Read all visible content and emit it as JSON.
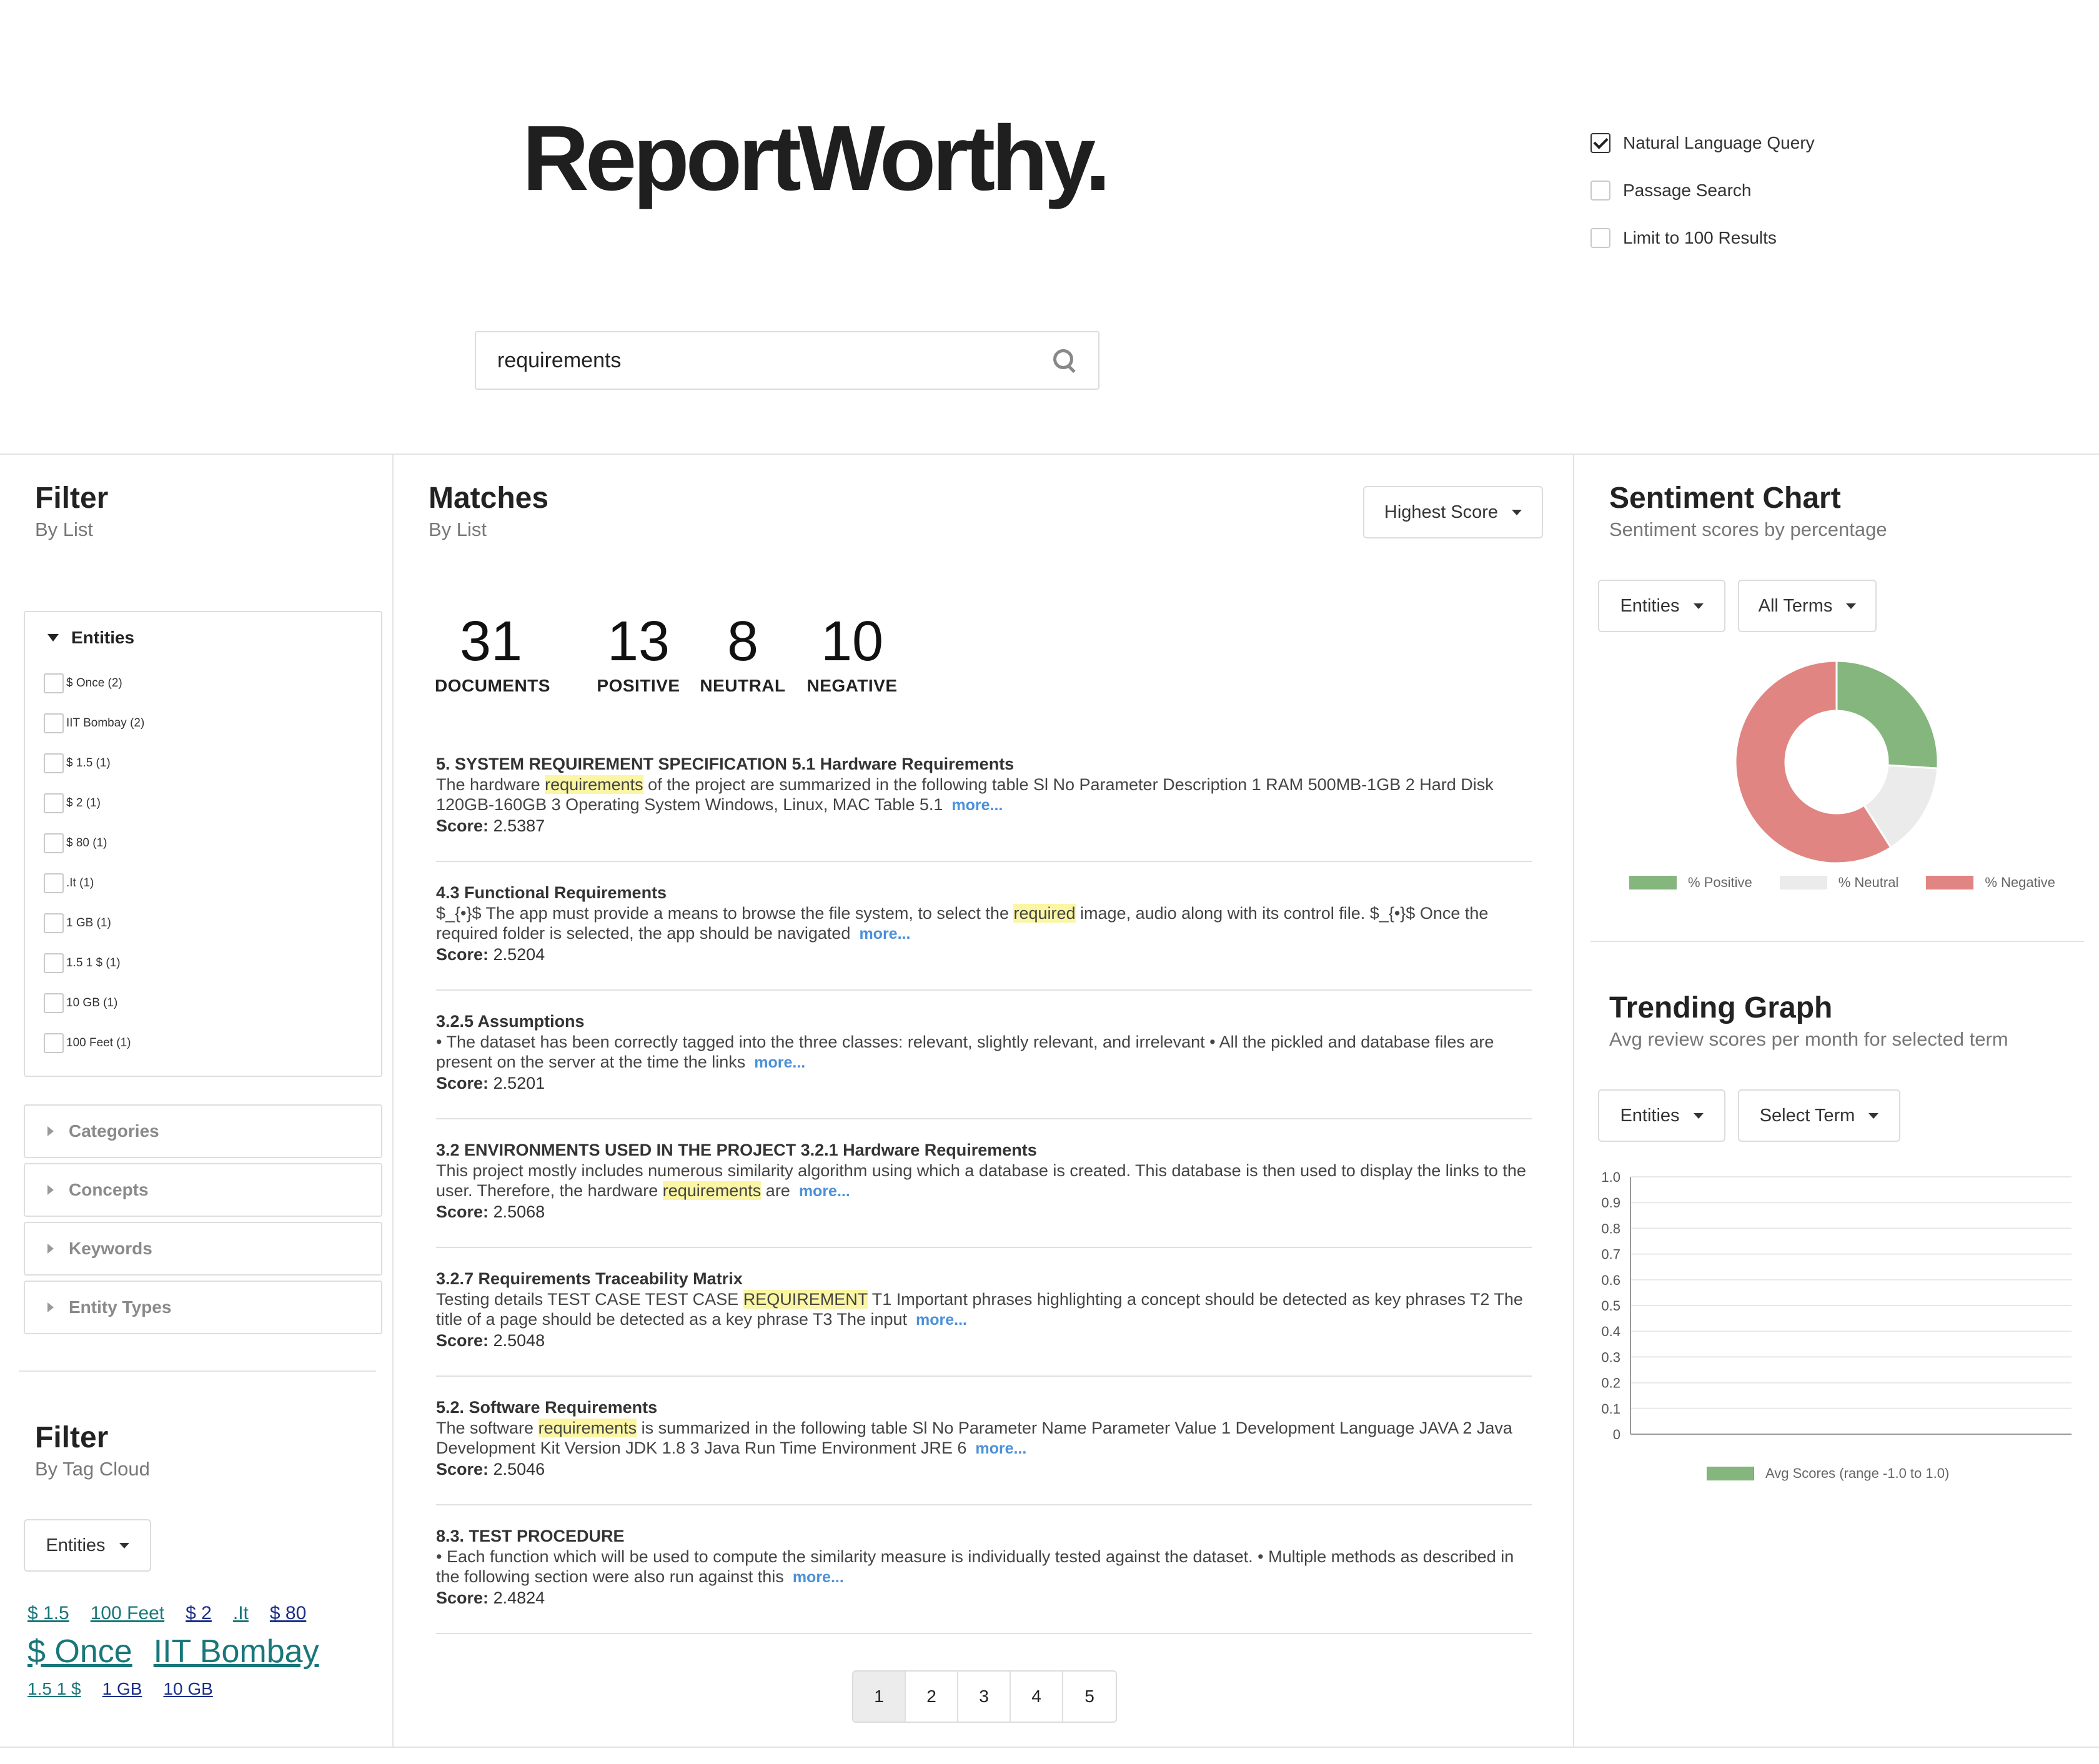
{
  "header": {
    "logo": "ReportWorthy.",
    "options": [
      {
        "label": "Natural Language Query",
        "checked": true
      },
      {
        "label": "Passage Search",
        "checked": false
      },
      {
        "label": "Limit to 100 Results",
        "checked": false
      }
    ],
    "search": {
      "value": "requirements",
      "icon": "search-icon"
    }
  },
  "filter_list": {
    "title": "Filter",
    "subtitle": "By List",
    "entities": {
      "label": "Entities",
      "items": [
        "$ Once (2)",
        "IIT Bombay (2)",
        "$ 1.5 (1)",
        "$ 2 (1)",
        "$ 80 (1)",
        ".It (1)",
        "1 GB (1)",
        "1.5 1 $ (1)",
        "10 GB (1)",
        "100 Feet (1)"
      ]
    },
    "collapsed": [
      "Categories",
      "Concepts",
      "Keywords",
      "Entity Types"
    ]
  },
  "filter_cloud": {
    "title": "Filter",
    "subtitle": "By Tag Cloud",
    "dropdown": "Entities",
    "tags_row1": [
      "$ 1.5",
      "100 Feet",
      "$ 2",
      ".It",
      "$ 80"
    ],
    "tags_row2": [
      "$ Once",
      "IIT Bombay"
    ],
    "tags_row3": [
      "1.5 1 $",
      "1 GB",
      "10 GB"
    ]
  },
  "matches": {
    "title": "Matches",
    "subtitle": "By List",
    "sort": "Highest Score",
    "stats": [
      {
        "num": "31",
        "label": "DOCUMENTS"
      },
      {
        "num": "13",
        "label": "POSITIVE"
      },
      {
        "num": "8",
        "label": "NEUTRAL"
      },
      {
        "num": "10",
        "label": "NEGATIVE"
      }
    ],
    "more_label": "more...",
    "score_label": "Score:",
    "results": [
      {
        "title": "5. SYSTEM REQUIREMENT SPECIFICATION 5.1 Hardware Requirements",
        "pre": "The hardware ",
        "hl": "requirements",
        "post": " of the project are summarized in the following table Sl No Parameter Description 1 RAM 500MB-1GB 2 Hard Disk 120GB-160GB 3 Operating System Windows, Linux, MAC Table 5.1",
        "score": "2.5387"
      },
      {
        "title": "4.3 Functional Requirements",
        "pre": "$_{•}$ The app must provide a means to browse the file system, to select the ",
        "hl": "required",
        "post": " image, audio along with its control file. $_{•}$ Once the required folder is selected, the app should be navigated",
        "score": "2.5204"
      },
      {
        "title": "3.2.5 Assumptions",
        "pre": "• The dataset has been correctly tagged into the three classes:  relevant, slightly relevant,  and  irrelevant • All the pickled and database files are present on the server at the time the links",
        "hl": "",
        "post": "",
        "score": "2.5201"
      },
      {
        "title": "3.2 ENVIRONMENTS USED IN THE PROJECT 3.2.1 Hardware Requirements",
        "pre": "This project mostly includes numerous similarity algorithm using which a database is created. This database is then used to display the links to the user. Therefore, the hardware ",
        "hl": "requirements",
        "post": " are",
        "score": "2.5068"
      },
      {
        "title": "3.2.7 Requirements Traceability Matrix",
        "pre": "Testing details TEST CASE TEST CASE ",
        "hl": "REQUIREMENT",
        "post": " T1 Important phrases highlighting a concept should be detected as key phrases T2 The title of a page should be detected as a key phrase T3 The input",
        "score": "2.5048"
      },
      {
        "title": "5.2. Software Requirements",
        "pre": "The software ",
        "hl": "requirements",
        "post": " is summarized in the following table Sl No Parameter Name Parameter Value 1 Development Language JAVA 2 Java Development Kit Version JDK 1.8 3 Java Run Time Environment JRE 6",
        "score": "2.5046"
      },
      {
        "title": "8.3. TEST PROCEDURE",
        "pre": "• Each function which will be used to compute the similarity measure is individually tested against the dataset. • Multiple methods as described in the following section were also run against this",
        "hl": "",
        "post": "",
        "score": "2.4824"
      }
    ],
    "pages": [
      "1",
      "2",
      "3",
      "4",
      "5"
    ],
    "active_page": "1"
  },
  "sentiment": {
    "title": "Sentiment Chart",
    "subtitle": "Sentiment scores by percentage",
    "dropdown1": "Entities",
    "dropdown2": "All Terms",
    "legend": [
      "% Positive",
      "% Neutral",
      "% Negative"
    ]
  },
  "trending": {
    "title": "Trending Graph",
    "subtitle": "Avg review scores per month for selected term",
    "dropdown1": "Entities",
    "dropdown2": "Select Term",
    "legend": "Avg Scores (range -1.0 to 1.0)"
  },
  "chart_data": [
    {
      "type": "pie",
      "categories": [
        "% Positive",
        "% Neutral",
        "% Negative"
      ],
      "values": [
        26,
        15,
        59
      ],
      "colors": [
        "#85b67e",
        "#ebebeb",
        "#e08582"
      ],
      "style": "doughnut",
      "legend": "bottom"
    },
    {
      "type": "bar",
      "categories": [],
      "series": [
        {
          "name": "Avg Scores (range -1.0 to 1.0)",
          "values": []
        }
      ],
      "ylim": [
        0,
        1.0
      ],
      "yticks": [
        "0",
        "0.1",
        "0.2",
        "0.3",
        "0.4",
        "0.5",
        "0.6",
        "0.7",
        "0.8",
        "0.9",
        "1.0"
      ],
      "color": "#85b67e",
      "grid": true,
      "legend": "bottom"
    }
  ]
}
